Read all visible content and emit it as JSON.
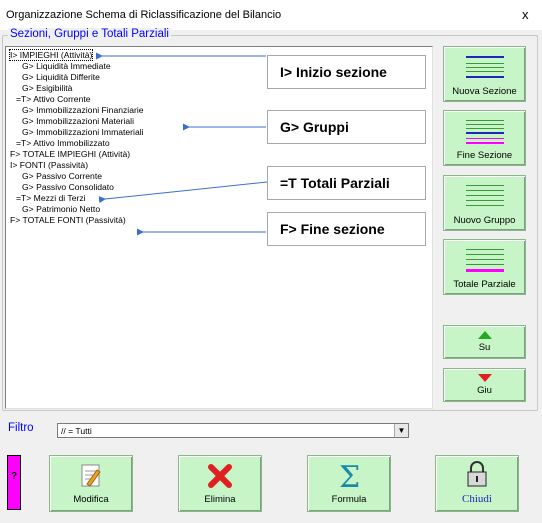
{
  "window": {
    "title": "Organizzazione Schema di Riclassificazione del Bilancio",
    "close_glyph": "x"
  },
  "sections_group": {
    "label": "Sezioni, Gruppi e Totali Parziali"
  },
  "tree": [
    "I> IMPIEGHI (Attività)",
    "G> Liquidità Immediate",
    "G> Liquidità Differite",
    "G> Esigibilità",
    "=T> Attivo Corrente",
    "G> Immobilizzazioni Finanziarie",
    "G> Immobilizzazioni Materiali",
    "G> Immobilizzazioni Immateriali",
    "=T> Attivo Immobilizzato",
    "F> TOTALE IMPIEGHI (Attività)",
    "I> FONTI (Passività)",
    "G> Passivo Corrente",
    "G> Passivo Consolidato",
    "=T> Mezzi di Terzi",
    "G> Patrimonio Netto",
    "F> TOTALE FONTI (Passività)"
  ],
  "callouts": {
    "inizio": "I> Inizio sezione",
    "gruppi": "G> Gruppi",
    "totali": "=T Totali Parziali",
    "fine": "F> Fine sezione"
  },
  "side_buttons": {
    "nuova_sezione": "Nuova Sezione",
    "fine_sezione": "Fine Sezione",
    "nuovo_gruppo": "Nuovo Gruppo",
    "totale_parziale": "Totale Parziale",
    "su": "Su",
    "giu": "Giu"
  },
  "filter": {
    "label": "Filtro",
    "value": "// = Tutti"
  },
  "bottom_buttons": {
    "help": "?",
    "modifica": "Modifica",
    "elimina": "Elimina",
    "formula": "Formula",
    "chiudi": "Chiudi"
  },
  "colors": {
    "accent_blue": "#0000ff",
    "button_green": "#c8f5c8",
    "arrow_blue": "#3a6fd0",
    "help_magenta": "#ff00ff"
  }
}
